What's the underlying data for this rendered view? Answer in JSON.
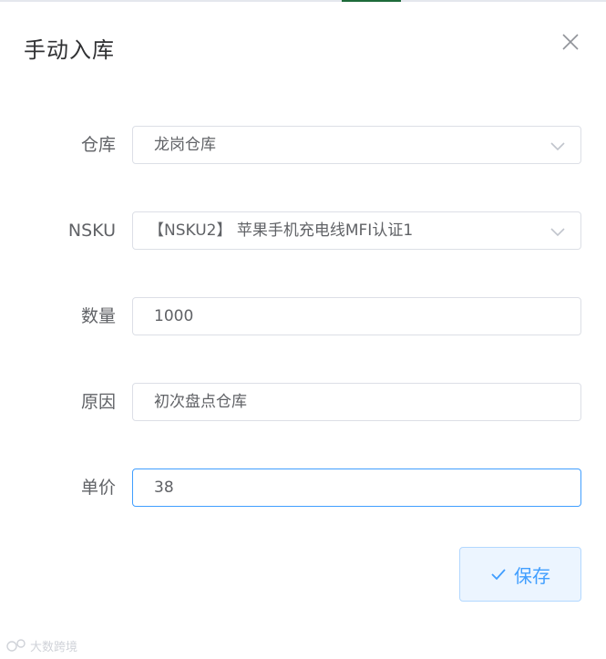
{
  "dialog": {
    "title": "手动入库"
  },
  "form": {
    "warehouse": {
      "label": "仓库",
      "value": "龙岗仓库"
    },
    "nsku": {
      "label": "NSKU",
      "value": "【NSKU2】 苹果手机充电线MFI认证1"
    },
    "quantity": {
      "label": "数量",
      "value": "1000"
    },
    "reason": {
      "label": "原因",
      "value": "初次盘点仓库"
    },
    "unit_price": {
      "label": "单价",
      "value": "38"
    }
  },
  "actions": {
    "save_label": "保存"
  },
  "watermark": {
    "text": "大数跨境"
  },
  "colors": {
    "primary": "#409eff",
    "border": "#dcdfe6",
    "save_bg": "#ecf5ff"
  },
  "icons": {
    "close": "close-icon",
    "dropdown": "chevron-down-icon",
    "check": "check-icon"
  }
}
